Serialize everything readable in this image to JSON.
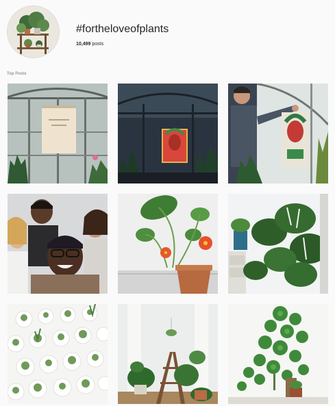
{
  "header": {
    "hashtag": "#fortheloveofplants",
    "post_count_number": "10,499",
    "post_count_suffix": " posts",
    "avatar_icon": "plant-shelf-avatar-icon"
  },
  "sections": {
    "top_posts_label": "Top Posts"
  },
  "posts": [
    {
      "name": "post-greenhouse-banner",
      "subject": "greenhouse-banner"
    },
    {
      "name": "post-greenhouse-red-poster",
      "subject": "greenhouse-poster"
    },
    {
      "name": "post-man-hanging-poster",
      "subject": "man-hanging-poster"
    },
    {
      "name": "post-group-selfie",
      "subject": "group-selfie"
    },
    {
      "name": "post-nasturtium-pot",
      "subject": "nasturtium"
    },
    {
      "name": "post-monstera-shelf",
      "subject": "monstera"
    },
    {
      "name": "post-succulent-cups",
      "subject": "succulents"
    },
    {
      "name": "post-plant-ladder",
      "subject": "ladder-plants"
    },
    {
      "name": "post-pilea-plant",
      "subject": "pilea"
    }
  ],
  "colors": {
    "background": "#fafafa",
    "text": "#262626",
    "muted": "#999999"
  }
}
